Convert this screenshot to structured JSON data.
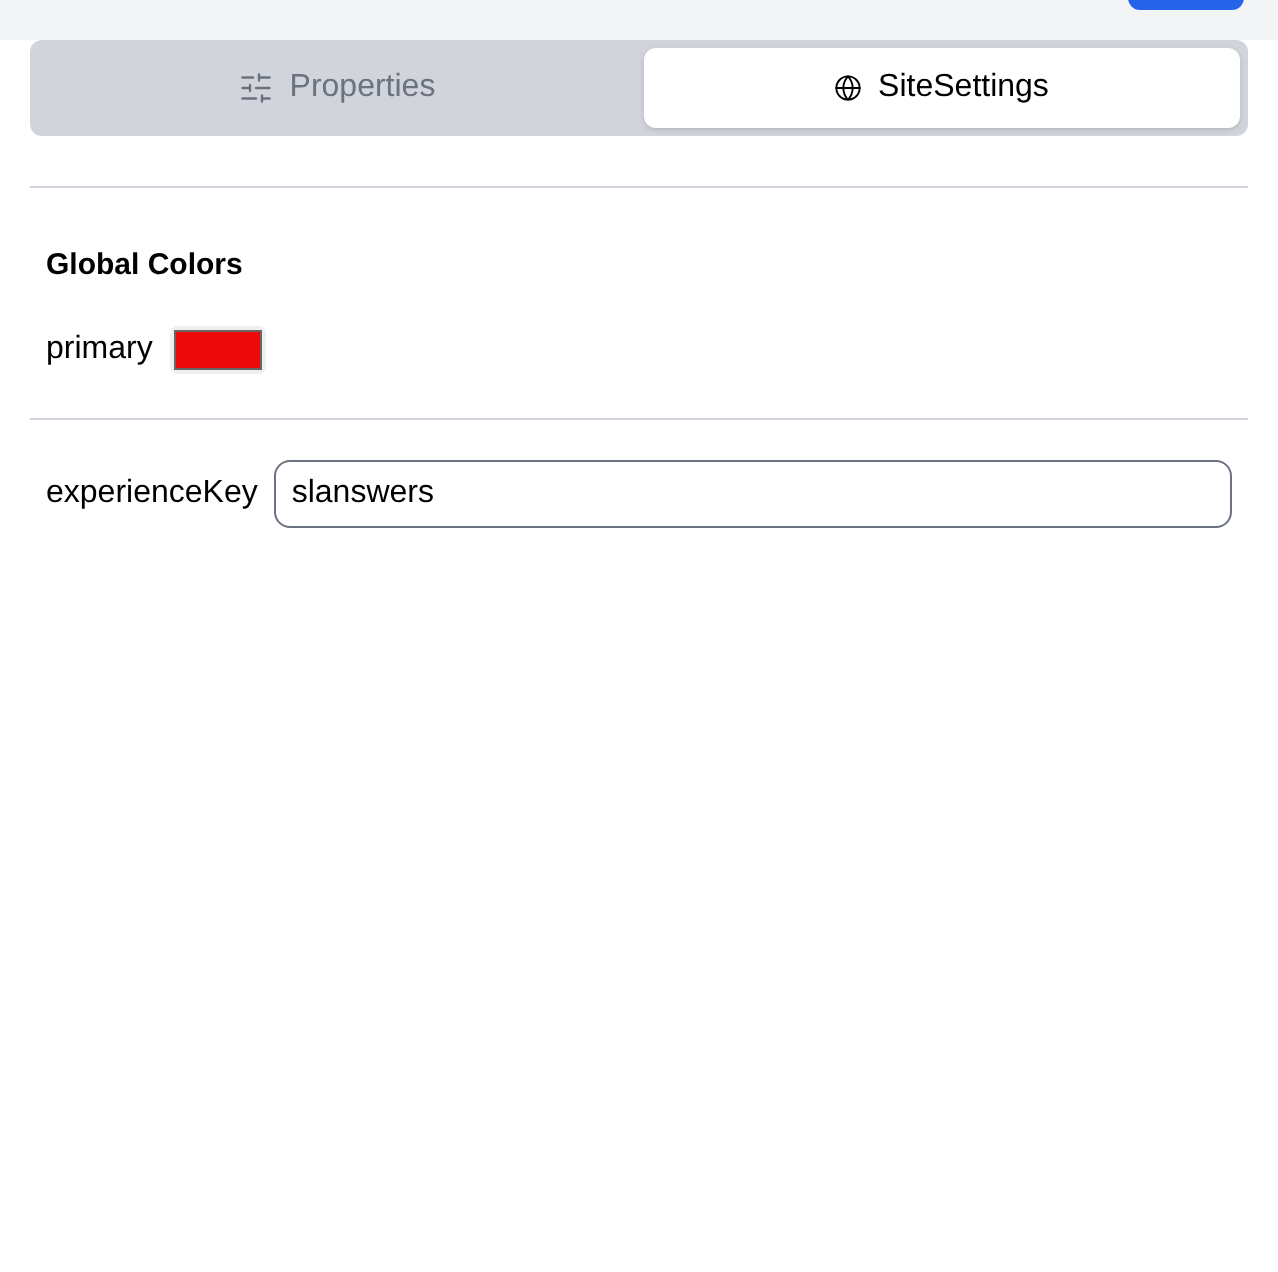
{
  "tabs": [
    {
      "label": "Properties",
      "selected": false
    },
    {
      "label": "SiteSettings",
      "selected": true
    }
  ],
  "global_colors": {
    "title": "Global Colors",
    "items": [
      {
        "label": "primary",
        "color": "#ee0a0a"
      }
    ]
  },
  "fields": [
    {
      "label": "experienceKey",
      "value": "slanswers"
    }
  ]
}
